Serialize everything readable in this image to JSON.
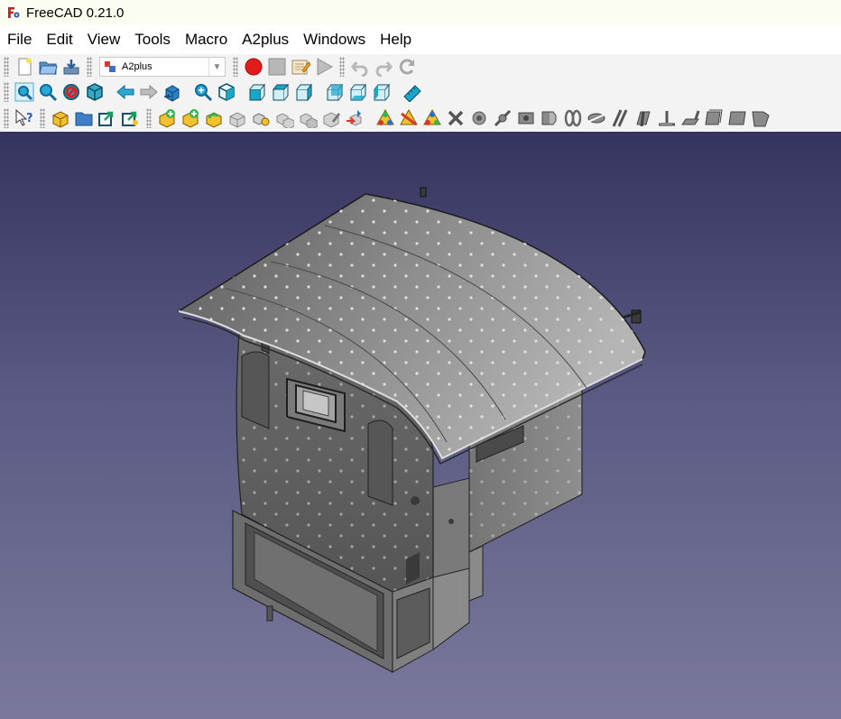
{
  "window": {
    "title": "FreeCAD 0.21.0"
  },
  "menu": {
    "file": "File",
    "edit": "Edit",
    "view": "View",
    "tools": "Tools",
    "macro": "Macro",
    "a2plus": "A2plus",
    "windows": "Windows",
    "help": "Help"
  },
  "toolbar": {
    "workbench_selector": {
      "value": "A2plus"
    }
  },
  "icons": {
    "file_toolbar": [
      "new-document-icon",
      "open-icon",
      "save-icon"
    ],
    "macro_toolbar": [
      "record-macro-icon",
      "stop-macro-icon",
      "edit-macro-icon",
      "run-macro-icon"
    ],
    "edit_toolbar": [
      "undo-icon",
      "redo-icon",
      "refresh-icon"
    ],
    "view_toolbar": [
      "fit-all-icon",
      "fit-selection-icon",
      "draw-style-icon",
      "bounding-box-icon",
      "back-icon",
      "forward-icon",
      "sync-view-icon",
      "zoom-icon",
      "isometric-icon",
      "front-view-icon",
      "top-view-icon",
      "right-view-icon",
      "rear-view-icon",
      "bottom-view-icon",
      "left-view-icon",
      "measure-icon"
    ],
    "a2plus_toolbar": [
      "whats-this-icon",
      "add-part-icon",
      "open-folder-icon",
      "import-icon",
      "import-shape-icon",
      "add-subassembly-icon",
      "add-part-variant-icon",
      "update-imports-icon",
      "convert-part-icon",
      "duplicate-part-icon",
      "edit-part-icon",
      "move-part-icon",
      "move-part-under-constraint-icon",
      "repair-tree-icon",
      "solve-constraints-icon",
      "flip-constraint-icon",
      "toggle-transparency-icon",
      "delete-constraints-icon",
      "point-identity-icon",
      "point-on-line-icon",
      "point-on-plane-icon",
      "sphere-center-icon",
      "circular-edge-icon",
      "axis-identity-icon",
      "axis-parallel-icon",
      "axis-plane-parallel-icon",
      "axis-plane-angle-icon",
      "axis-plane-normal-icon",
      "plane-parallel-icon",
      "planes-coincident-icon",
      "angled-planes-icon",
      "center-of-mass-icon"
    ]
  },
  "colors": {
    "titlebar": "#fbfdf1",
    "toolbar": "#f3f3f3",
    "viewport_top": "#34345f",
    "viewport_bottom": "#7a799c",
    "accent_cyan": "#1aa6c8"
  }
}
